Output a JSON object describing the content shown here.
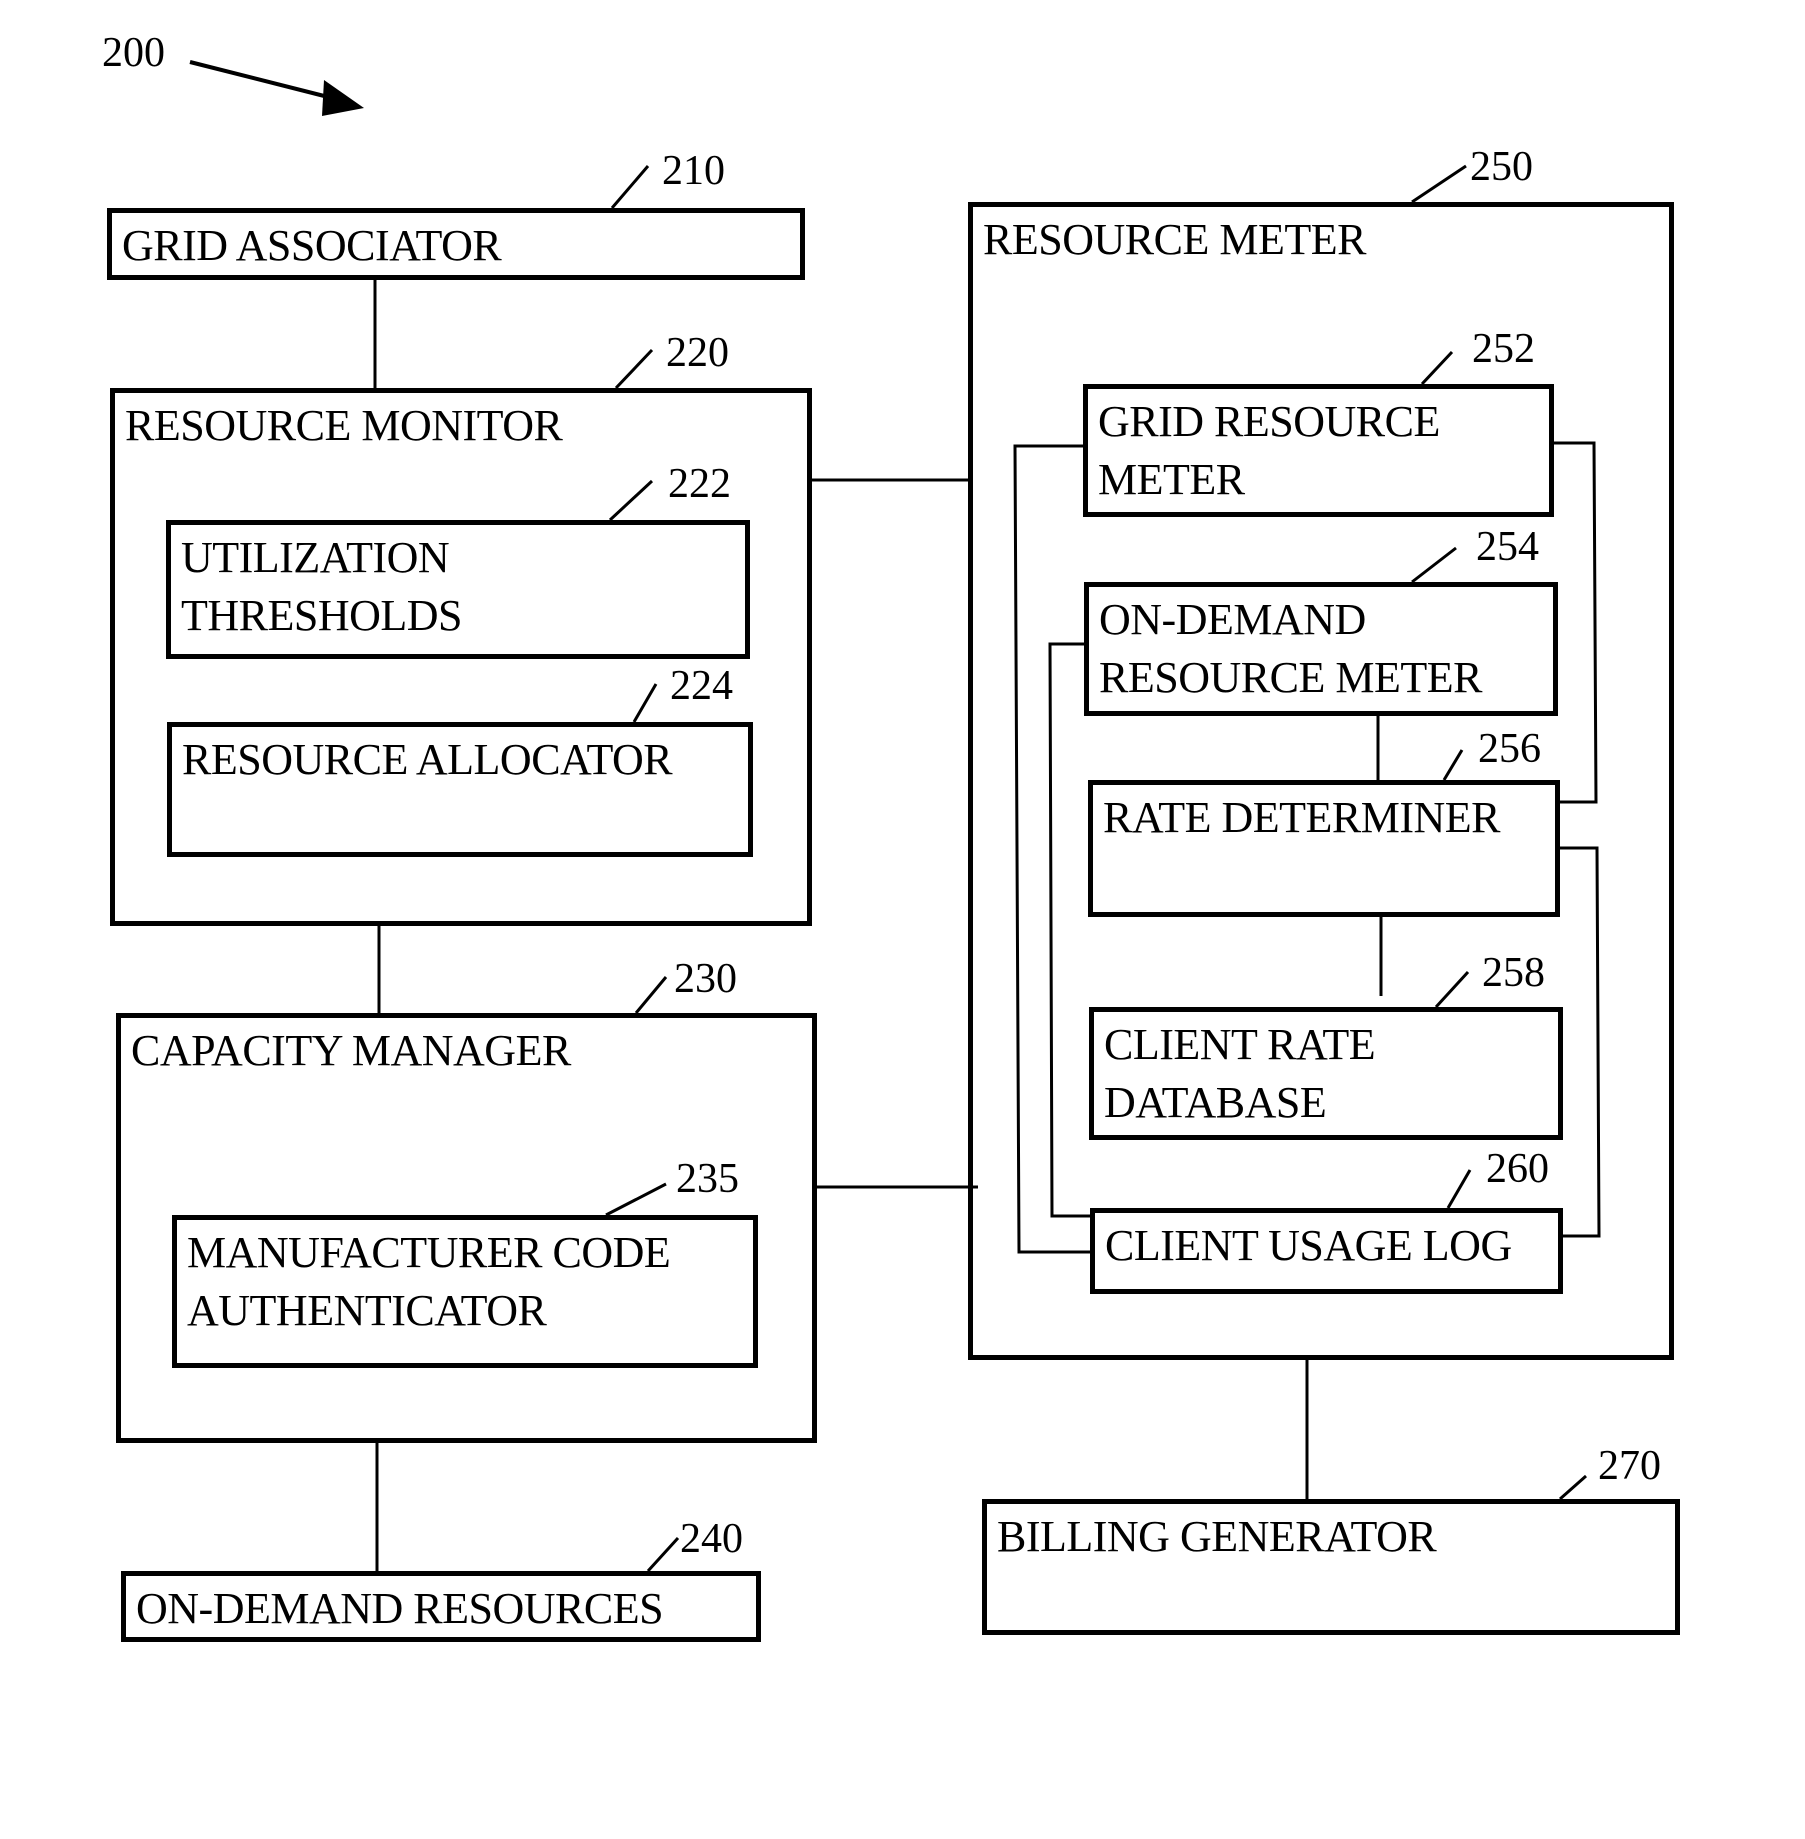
{
  "figure": {
    "reference": "200"
  },
  "blocks": {
    "grid_associator": {
      "label": "GRID ASSOCIATOR",
      "ref": "210"
    },
    "resource_monitor": {
      "label": "RESOURCE MONITOR",
      "ref": "220"
    },
    "utilization_thresholds": {
      "label": "UTILIZATION\nTHRESHOLDS",
      "ref": "222"
    },
    "resource_allocator": {
      "label": "RESOURCE ALLOCATOR",
      "ref": "224"
    },
    "capacity_manager": {
      "label": "CAPACITY MANAGER",
      "ref": "230"
    },
    "manufacturer_code_authenticator": {
      "label": "MANUFACTURER CODE\nAUTHENTICATOR",
      "ref": "235"
    },
    "on_demand_resources": {
      "label": "ON-DEMAND RESOURCES",
      "ref": "240"
    },
    "resource_meter": {
      "label": "RESOURCE METER",
      "ref": "250"
    },
    "grid_resource_meter": {
      "label": "GRID RESOURCE\nMETER",
      "ref": "252"
    },
    "on_demand_resource_meter": {
      "label": "ON-DEMAND\nRESOURCE METER",
      "ref": "254"
    },
    "rate_determiner": {
      "label": "RATE DETERMINER",
      "ref": "256"
    },
    "client_rate_database": {
      "label": "CLIENT RATE\nDATABASE",
      "ref": "258"
    },
    "client_usage_log": {
      "label": "CLIENT USAGE LOG",
      "ref": "260"
    },
    "billing_generator": {
      "label": "BILLING GENERATOR",
      "ref": "270"
    }
  },
  "connections": [
    [
      "grid_associator",
      "resource_monitor"
    ],
    [
      "resource_monitor",
      "capacity_manager"
    ],
    [
      "capacity_manager",
      "on_demand_resources"
    ],
    [
      "resource_monitor",
      "resource_meter"
    ],
    [
      "capacity_manager",
      "resource_meter"
    ],
    [
      "resource_meter",
      "billing_generator"
    ],
    [
      "on_demand_resource_meter",
      "rate_determiner"
    ],
    [
      "rate_determiner",
      "client_rate_database"
    ],
    [
      "grid_resource_meter",
      "client_usage_log"
    ],
    [
      "on_demand_resource_meter",
      "client_usage_log"
    ],
    [
      "grid_resource_meter",
      "rate_determiner"
    ],
    [
      "rate_determiner",
      "client_usage_log"
    ]
  ]
}
